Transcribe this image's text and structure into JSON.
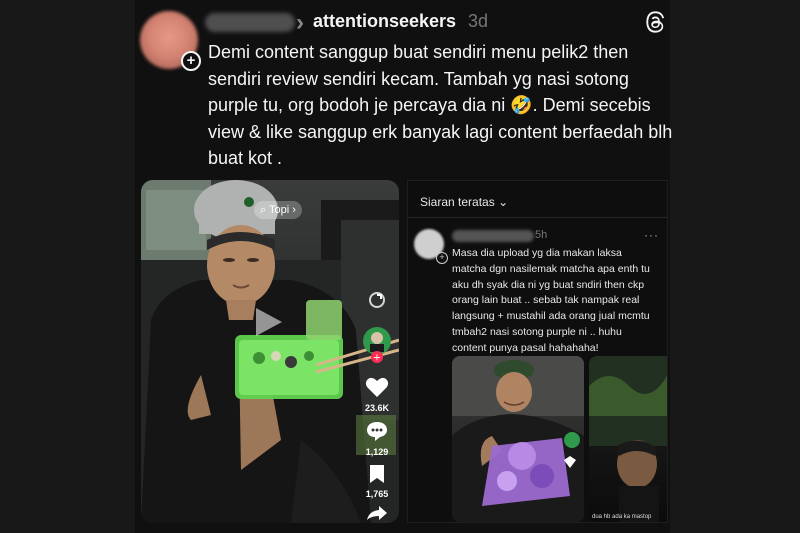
{
  "post": {
    "community": "attentionseekers",
    "time": "3d",
    "body": "Demi content sanggup buat sendiri menu pelik2 then sendiri review sendiri kecam. Tambah yg nasi sotong purple tu, org bodoh je percaya dia ni 🤣. Demi secebis view & like sanggup erk banyak lagi content berfaedah blh buat kot ."
  },
  "video": {
    "tag": "Topi",
    "likes": "23.6K",
    "comments": "1,129",
    "saves": "1,765"
  },
  "comment_card": {
    "sort_label": "Siaran teratas",
    "time": "5h",
    "text": "Masa dia upload yg dia makan laksa matcha dgn nasilemak matcha apa enth tu aku dh syak dia ni yg buat sndiri then ckp orang lain buat .. sebab tak nampak real langsung + mustahil ada orang jual mcmtu tmbah2 nasi sotong purple ni .. huhu content punya pasal hahahaha!",
    "thumb_caption": "dua hb ada ka mastop"
  }
}
